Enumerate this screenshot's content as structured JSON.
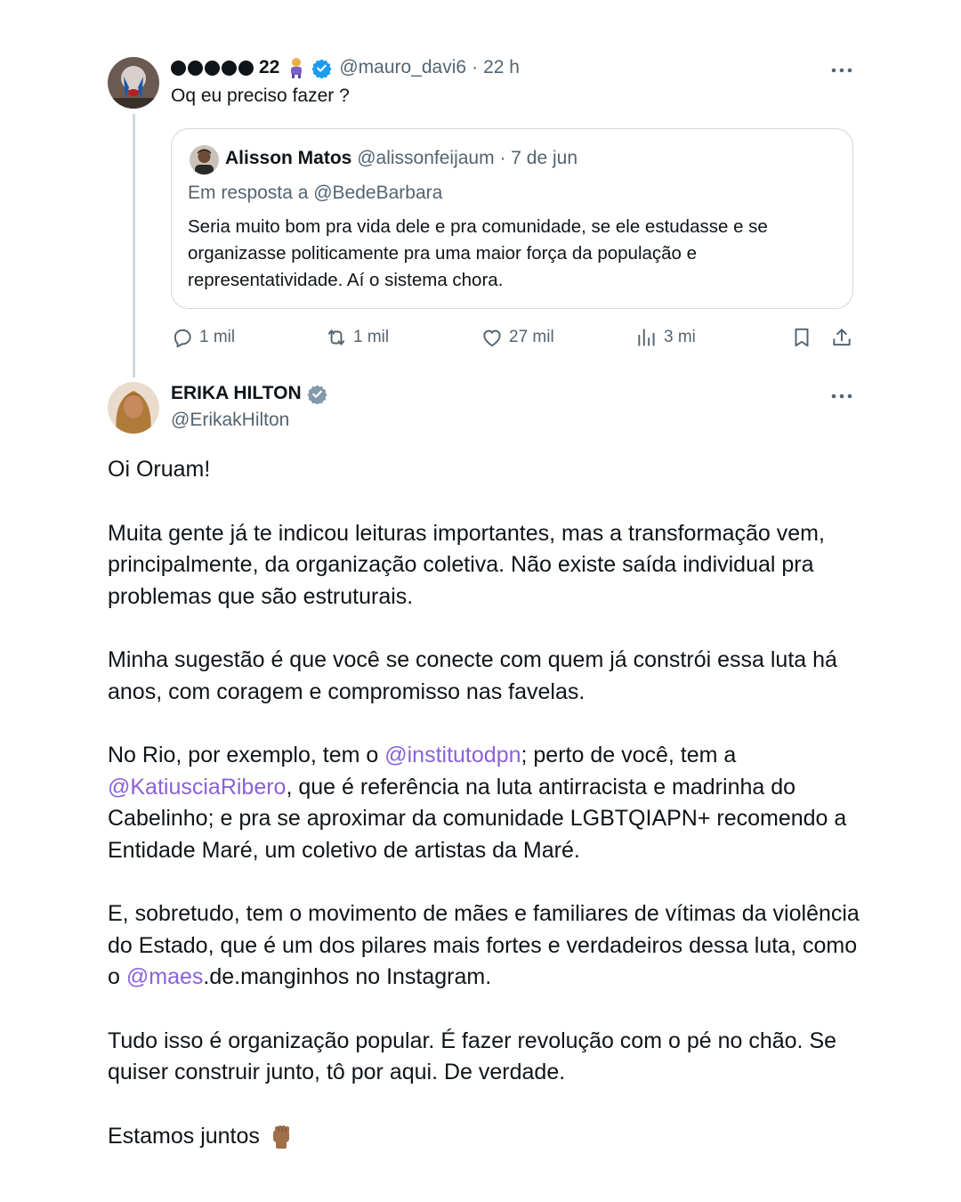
{
  "reply_tweet": {
    "display_suffix": "22",
    "handle": "@mauro_davi6",
    "separator": "·",
    "time": "22 h",
    "text": "Oq eu preciso fazer ?",
    "quoted": {
      "name": "Alisson Matos",
      "handle": "@alissonfeijaum",
      "separator": "·",
      "date": "7 de jun",
      "reply_to": "Em resposta a @BedeBarbara",
      "text_lines": [
        "Seria muito bom pra vida dele e pra comunidade, se ele estudasse e se",
        "organizasse politicamente pra uma maior força da população e",
        "representatividade. Aí o sistema chora."
      ]
    },
    "actions": {
      "replies": "1 mil",
      "retweets": "1 mil",
      "likes": "27 mil",
      "views": "3 mi"
    }
  },
  "main_tweet": {
    "name": "ERIKA HILTON",
    "handle": "@ErikakHilton",
    "p1": "Oi Oruam!",
    "p2": "Muita gente já te indicou leituras importantes, mas a transformação vem, principalmente, da organização coletiva. Não existe saída individual pra problemas que são estruturais.",
    "p3": "Minha sugestão é que você se conecte com quem já constrói essa luta há anos, com coragem e compromisso nas favelas.",
    "p4_a": "No Rio, por exemplo, tem o ",
    "p4_link1": "@institutodpn",
    "p4_b": "; perto de você, tem a ",
    "p4_link2": "@KatiusciaRibero",
    "p4_c": ", que é referência na luta antirracista e madrinha do Cabelinho; e pra se aproximar da comunidade LGBTQIAPN+ recomendo a Entidade Maré, um coletivo de artistas da Maré.",
    "p5_a": "E, sobretudo, tem o movimento de mães e familiares de vítimas da violência do Estado, que é um dos pilares mais fortes e verdadeiros dessa luta, como o ",
    "p5_link": "@maes",
    "p5_b": ".de.manginhos no Instagram.",
    "p6": "Tudo isso é organização popular. É fazer revolução com o pé no chão. Se quiser construir junto, tô por aqui. De verdade.",
    "p7": "Estamos juntos"
  },
  "colors": {
    "verified": "#1d9bf0",
    "link": "#8a62d8",
    "muted": "#536471",
    "border": "#cfd9de"
  },
  "icons": [
    "verified-badge-icon",
    "more-options-icon",
    "reply-icon",
    "retweet-icon",
    "like-icon",
    "views-icon",
    "bookmark-icon",
    "share-icon",
    "raised-fist-emoji",
    "person-emoji"
  ]
}
